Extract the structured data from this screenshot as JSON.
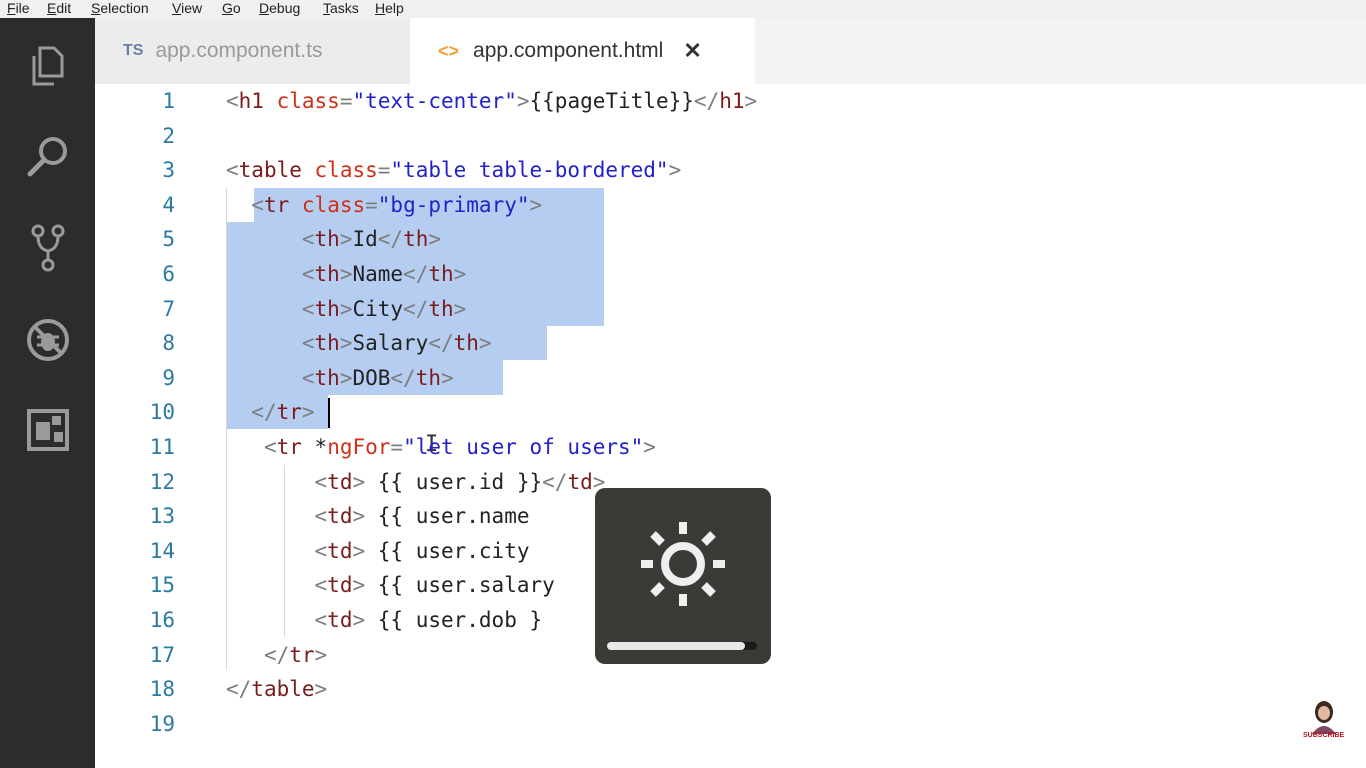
{
  "menu": [
    "File",
    "Edit",
    "Selection",
    "View",
    "Go",
    "Debug",
    "Tasks",
    "Help"
  ],
  "tabs": {
    "tab1": {
      "badge": "TS",
      "label": "app.component.ts"
    },
    "tab2": {
      "icon": "<>",
      "label": "app.component.html",
      "close": "✕"
    }
  },
  "activity_bar": [
    "explorer-icon",
    "search-icon",
    "source-control-icon",
    "debug-icon",
    "extensions-icon"
  ],
  "lines": [
    {
      "n": "1",
      "t": [
        [
          "tag",
          "<"
        ],
        [
          "tn",
          "h1"
        ],
        [
          "tx",
          " "
        ],
        [
          "an",
          "class"
        ],
        [
          "tag",
          "="
        ],
        [
          "av",
          "\"text-center\""
        ],
        [
          "tag",
          ">"
        ],
        [
          "tx",
          "{{pageTitle}}"
        ],
        [
          "tag",
          "</"
        ],
        [
          "tn",
          "h1"
        ],
        [
          "tag",
          ">"
        ]
      ]
    },
    {
      "n": "2",
      "t": []
    },
    {
      "n": "3",
      "t": [
        [
          "tag",
          "<"
        ],
        [
          "tn",
          "table"
        ],
        [
          "tx",
          " "
        ],
        [
          "an",
          "class"
        ],
        [
          "tag",
          "="
        ],
        [
          "av",
          "\"table table-bordered\""
        ],
        [
          "tag",
          ">"
        ]
      ]
    },
    {
      "n": "4",
      "t": [
        [
          "tx",
          "  "
        ],
        [
          "tag",
          "<"
        ],
        [
          "tn",
          "tr"
        ],
        [
          "tx",
          " "
        ],
        [
          "an",
          "class"
        ],
        [
          "tag",
          "="
        ],
        [
          "av",
          "\"bg-primary\""
        ],
        [
          "tag",
          ">"
        ]
      ]
    },
    {
      "n": "5",
      "t": [
        [
          "tx",
          "      "
        ],
        [
          "tag",
          "<"
        ],
        [
          "tn",
          "th"
        ],
        [
          "tag",
          ">"
        ],
        [
          "tx",
          "Id"
        ],
        [
          "tag",
          "</"
        ],
        [
          "tn",
          "th"
        ],
        [
          "tag",
          ">"
        ]
      ]
    },
    {
      "n": "6",
      "t": [
        [
          "tx",
          "      "
        ],
        [
          "tag",
          "<"
        ],
        [
          "tn",
          "th"
        ],
        [
          "tag",
          ">"
        ],
        [
          "tx",
          "Name"
        ],
        [
          "tag",
          "</"
        ],
        [
          "tn",
          "th"
        ],
        [
          "tag",
          ">"
        ]
      ]
    },
    {
      "n": "7",
      "t": [
        [
          "tx",
          "      "
        ],
        [
          "tag",
          "<"
        ],
        [
          "tn",
          "th"
        ],
        [
          "tag",
          ">"
        ],
        [
          "tx",
          "City"
        ],
        [
          "tag",
          "</"
        ],
        [
          "tn",
          "th"
        ],
        [
          "tag",
          ">"
        ]
      ]
    },
    {
      "n": "8",
      "t": [
        [
          "tx",
          "      "
        ],
        [
          "tag",
          "<"
        ],
        [
          "tn",
          "th"
        ],
        [
          "tag",
          ">"
        ],
        [
          "tx",
          "Salary"
        ],
        [
          "tag",
          "</"
        ],
        [
          "tn",
          "th"
        ],
        [
          "tag",
          ">"
        ]
      ]
    },
    {
      "n": "9",
      "t": [
        [
          "tx",
          "      "
        ],
        [
          "tag",
          "<"
        ],
        [
          "tn",
          "th"
        ],
        [
          "tag",
          ">"
        ],
        [
          "tx",
          "DOB"
        ],
        [
          "tag",
          "</"
        ],
        [
          "tn",
          "th"
        ],
        [
          "tag",
          ">"
        ]
      ]
    },
    {
      "n": "10",
      "t": [
        [
          "tx",
          "  "
        ],
        [
          "tag",
          "</"
        ],
        [
          "tn",
          "tr"
        ],
        [
          "tag",
          ">"
        ]
      ]
    },
    {
      "n": "11",
      "t": [
        [
          "tx",
          "   "
        ],
        [
          "tag",
          "<"
        ],
        [
          "tn",
          "tr"
        ],
        [
          "tx",
          " *"
        ],
        [
          "an",
          "ngFor"
        ],
        [
          "tag",
          "="
        ],
        [
          "av",
          "\"let user of users\""
        ],
        [
          "tag",
          ">"
        ]
      ]
    },
    {
      "n": "12",
      "t": [
        [
          "tx",
          "       "
        ],
        [
          "tag",
          "<"
        ],
        [
          "tn",
          "td"
        ],
        [
          "tag",
          ">"
        ],
        [
          "tx",
          " {{ user.id }}"
        ],
        [
          "tag",
          "</"
        ],
        [
          "tn",
          "td"
        ],
        [
          "tag",
          ">"
        ]
      ]
    },
    {
      "n": "13",
      "t": [
        [
          "tx",
          "       "
        ],
        [
          "tag",
          "<"
        ],
        [
          "tn",
          "td"
        ],
        [
          "tag",
          ">"
        ],
        [
          "tx",
          " {{ user.name "
        ]
      ]
    },
    {
      "n": "14",
      "t": [
        [
          "tx",
          "       "
        ],
        [
          "tag",
          "<"
        ],
        [
          "tn",
          "td"
        ],
        [
          "tag",
          ">"
        ],
        [
          "tx",
          " {{ user.city "
        ]
      ]
    },
    {
      "n": "15",
      "t": [
        [
          "tx",
          "       "
        ],
        [
          "tag",
          "<"
        ],
        [
          "tn",
          "td"
        ],
        [
          "tag",
          ">"
        ],
        [
          "tx",
          " {{ user.salary"
        ]
      ]
    },
    {
      "n": "16",
      "t": [
        [
          "tx",
          "       "
        ],
        [
          "tag",
          "<"
        ],
        [
          "tn",
          "td"
        ],
        [
          "tag",
          ">"
        ],
        [
          "tx",
          " {{ user.dob }"
        ]
      ]
    },
    {
      "n": "17",
      "t": [
        [
          "tx",
          "   "
        ],
        [
          "tag",
          "</"
        ],
        [
          "tn",
          "tr"
        ],
        [
          "tag",
          ">"
        ]
      ]
    },
    {
      "n": "18",
      "t": [
        [
          "tag",
          "</"
        ],
        [
          "tn",
          "table"
        ],
        [
          "tag",
          ">"
        ]
      ]
    },
    {
      "n": "19",
      "t": []
    }
  ],
  "brightness_overlay": {
    "icon": "brightness-icon",
    "level": 0.92
  },
  "channel_badge": {
    "label": "SUBSCRIBE"
  },
  "colors": {
    "activity_bar": "#2c2c2c",
    "line_number": "#2b7aa1",
    "selection": "#b6cdf2",
    "attr_name": "#d0301a",
    "attr_value": "#2222c8",
    "tag_name": "#7a1c1c"
  }
}
